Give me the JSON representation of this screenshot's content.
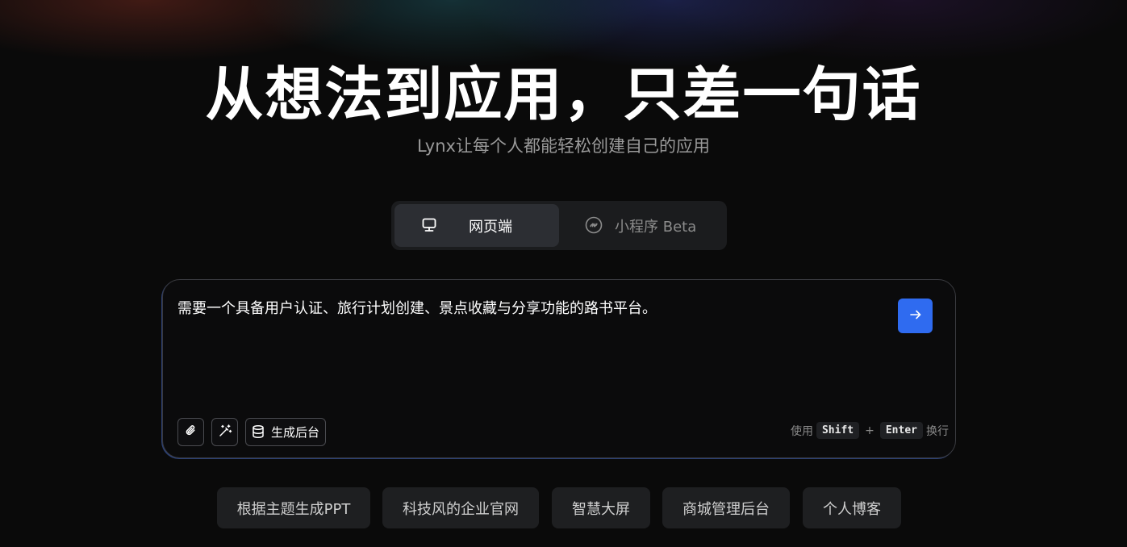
{
  "hero": {
    "title": "从想法到应用，只差一句话",
    "subtitle": "Lynx让每个人都能轻松创建自己的应用"
  },
  "mode_switch": {
    "tabs": [
      {
        "label": "网页端",
        "icon": "monitor-icon",
        "selected": true
      },
      {
        "label": "小程序 Beta",
        "icon": "miniprogram-icon",
        "selected": false
      }
    ]
  },
  "prompt": {
    "value": "需要一个具备用户认证、旅行计划创建、景点收藏与分享功能的路书平台。",
    "send_icon": "arrow-right-icon",
    "tools": {
      "attach_icon": "paperclip-icon",
      "enhance_icon": "magic-wand-icon",
      "backend_label": "生成后台",
      "backend_icon": "database-icon"
    },
    "hint": {
      "prefix": "使用",
      "key1": "Shift",
      "plus": "+",
      "key2": "Enter",
      "suffix": "换行"
    }
  },
  "suggestions": [
    {
      "label": "根据主题生成PPT"
    },
    {
      "label": "科技风的企业官网"
    },
    {
      "label": "智慧大屏"
    },
    {
      "label": "商城管理后台"
    },
    {
      "label": "个人博客"
    }
  ],
  "colors": {
    "background": "#0a0a0a",
    "accent": "#2f6bf0",
    "tab_selected": "#2c2e33",
    "chip_bg": "#1e1f21"
  }
}
